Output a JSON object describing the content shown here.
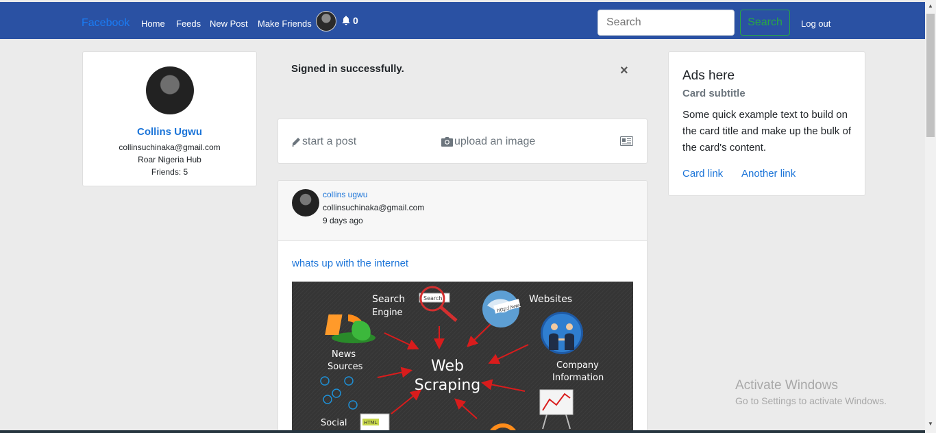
{
  "navbar": {
    "brand": "Facebook",
    "links": [
      "Home",
      "Feeds",
      "New Post",
      "Make Friends"
    ],
    "notification_count": "0",
    "search_placeholder": "Search",
    "search_button": "Search",
    "logout": "Log out"
  },
  "profile": {
    "name": "Collins Ugwu",
    "email": "collinsuchinaka@gmail.com",
    "organization": "Roar Nigeria Hub",
    "friends": "Friends: 5"
  },
  "alert": {
    "message": "Signed in successfully.",
    "close": "×"
  },
  "composer": {
    "start_post": "start a post",
    "upload_image": "upload an image"
  },
  "post": {
    "author": "collins ugwu",
    "email": "collinsuchinaka@gmail.com",
    "time": "9 days ago",
    "title": "whats up with the internet",
    "image_labels": {
      "center": [
        "Web",
        "Scraping"
      ],
      "search_engine": [
        "Search",
        "Engine"
      ],
      "search_box": "Search",
      "websites": "Websites",
      "news_sources": [
        "News",
        "Sources"
      ],
      "company_information": [
        "Company",
        "Information"
      ],
      "social_media": "Social",
      "url_tag": "http://www",
      "html_tag": "HTML"
    }
  },
  "ad": {
    "title": "Ads here",
    "subtitle": "Card subtitle",
    "text": "Some quick example text to build on the card title and make up the bulk of the card's content.",
    "link1": "Card link",
    "link2": "Another link"
  },
  "watermark": {
    "title": "Activate Windows",
    "subtitle": "Go to Settings to activate Windows."
  },
  "colors": {
    "navbar": "#2a51a3",
    "link": "#1b74d8",
    "success": "#28a745"
  }
}
